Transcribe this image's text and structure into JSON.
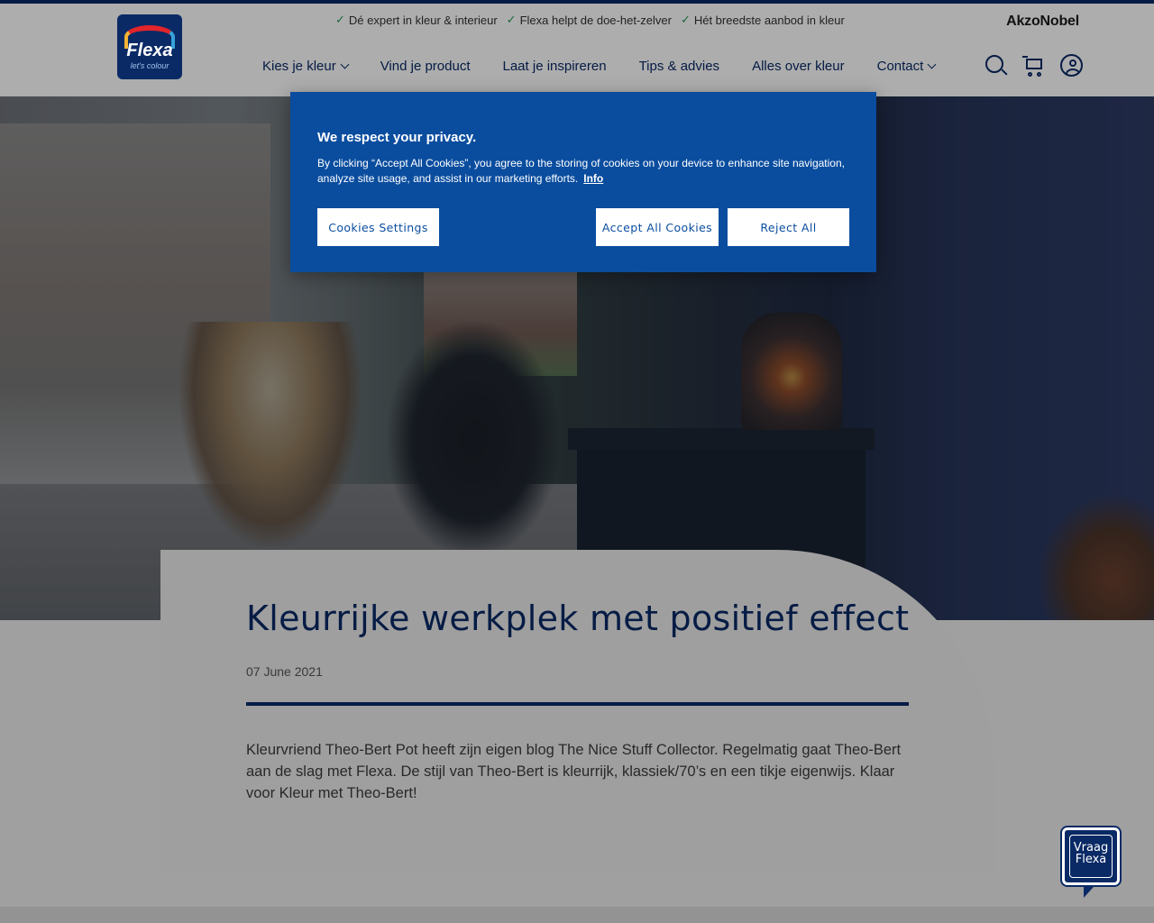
{
  "usp_bar": {
    "items": [
      "Dé expert in kleur & interieur",
      "Flexa helpt de doe-het-zelver",
      "Hét breedste aanbod in kleur"
    ],
    "brand": "AkzoNobel"
  },
  "header": {
    "logo_text": "Flexa",
    "logo_tagline": "let's colour",
    "nav": [
      {
        "label": "Kies je kleur",
        "has_dropdown": true
      },
      {
        "label": "Vind je product",
        "has_dropdown": false
      },
      {
        "label": "Laat je inspireren",
        "has_dropdown": false
      },
      {
        "label": "Tips & advies",
        "has_dropdown": false
      },
      {
        "label": "Alles over kleur",
        "has_dropdown": false
      },
      {
        "label": "Contact",
        "has_dropdown": true
      }
    ],
    "icons": [
      "search-icon",
      "cart-icon",
      "account-icon"
    ]
  },
  "article": {
    "title": "Kleurrijke werkplek met positief effect",
    "date": "07 June 2021",
    "intro": "Kleurvriend Theo-Bert Pot heeft zijn eigen blog The Nice Stuff Collector. Regelmatig gaat Theo-Bert aan de slag met Flexa. De stijl van Theo-Bert is kleurrijk, klassiek/70’s en een tikje eigenwijs. Klaar voor Kleur met Theo-Bert!"
  },
  "cookie_banner": {
    "title": "We respect your privacy.",
    "text": "By clicking “Accept All Cookies”, you agree to the storing of cookies on your device to enhance site navigation, analyze site usage, and assist in our marketing efforts.",
    "info_link": "Info",
    "settings_button": "Cookies Settings",
    "accept_button": "Accept All Cookies",
    "reject_button": "Reject All"
  },
  "chat_widget": {
    "line1": "Vraag",
    "line2": "Flexa"
  },
  "colors": {
    "brand_navy": "#0a2a66",
    "cookie_blue": "#0a4d9f",
    "check_green": "#2e9e5b"
  }
}
